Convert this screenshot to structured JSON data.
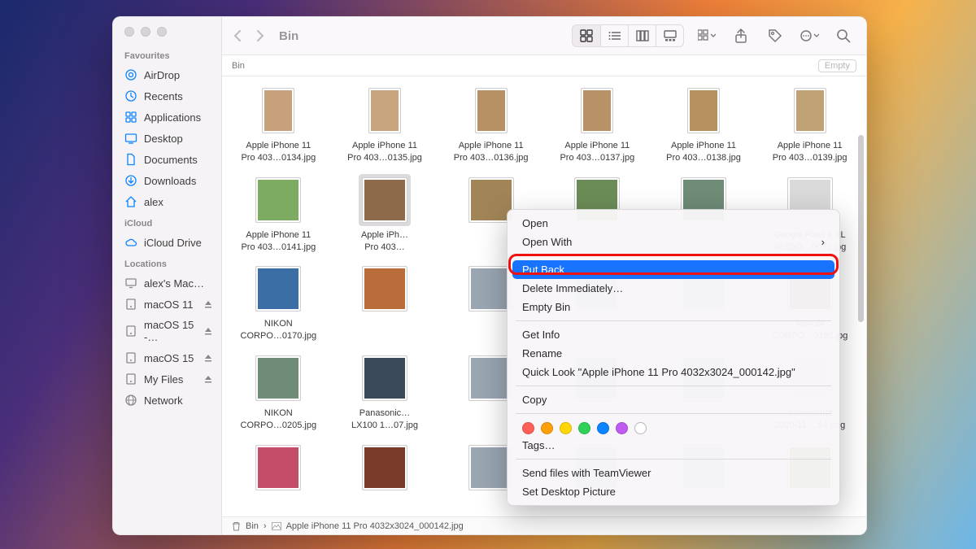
{
  "window": {
    "title": "Bin",
    "location_header": "Bin",
    "empty_button": "Empty"
  },
  "sidebar": {
    "sections": [
      {
        "label": "Favourites",
        "items": [
          {
            "name": "AirDrop",
            "icon": "airdrop"
          },
          {
            "name": "Recents",
            "icon": "clock"
          },
          {
            "name": "Applications",
            "icon": "apps"
          },
          {
            "name": "Desktop",
            "icon": "desktop"
          },
          {
            "name": "Documents",
            "icon": "doc"
          },
          {
            "name": "Downloads",
            "icon": "download"
          },
          {
            "name": "alex",
            "icon": "home"
          }
        ]
      },
      {
        "label": "iCloud",
        "items": [
          {
            "name": "iCloud Drive",
            "icon": "cloud"
          }
        ]
      },
      {
        "label": "Locations",
        "items": [
          {
            "name": "alex's Mac…",
            "icon": "computer"
          },
          {
            "name": "macOS 11",
            "icon": "disk",
            "eject": true
          },
          {
            "name": "macOS 15 -…",
            "icon": "disk",
            "eject": true
          },
          {
            "name": "macOS 15",
            "icon": "disk",
            "eject": true
          },
          {
            "name": "My Files",
            "icon": "disk",
            "eject": true
          },
          {
            "name": "Network",
            "icon": "globe"
          }
        ]
      }
    ]
  },
  "files": [
    {
      "label": "Apple iPhone 11\nPro 403…0134.jpg",
      "kind": "portrait"
    },
    {
      "label": "Apple iPhone 11\nPro 403…0135.jpg",
      "kind": "portrait"
    },
    {
      "label": "Apple iPhone 11\nPro 403…0136.jpg",
      "kind": "portrait"
    },
    {
      "label": "Apple iPhone 11\nPro 403…0137.jpg",
      "kind": "portrait"
    },
    {
      "label": "Apple iPhone 11\nPro 403…0138.jpg",
      "kind": "portrait"
    },
    {
      "label": "Apple iPhone 11\nPro 403…0139.jpg",
      "kind": "portrait"
    },
    {
      "label": "Apple iPhone 11\nPro 403…0141.jpg"
    },
    {
      "label": "Apple iPh…\nPro 403…",
      "selected": true
    },
    {
      "label": ""
    },
    {
      "label": ""
    },
    {
      "label": ""
    },
    {
      "label": "Google Pixel 4 XL\n4032x3…0072.jpg"
    },
    {
      "label": "NIKON\nCORPO…0170.jpg"
    },
    {
      "label": ""
    },
    {
      "label": ""
    },
    {
      "label": ""
    },
    {
      "label": ""
    },
    {
      "label": "NIKON\nCORPO…0192.jpg"
    },
    {
      "label": "NIKON\nCORPO…0205.jpg"
    },
    {
      "label": "Panasonic…\nLX100 1…07.jpg"
    },
    {
      "label": ""
    },
    {
      "label": ""
    },
    {
      "label": ""
    },
    {
      "label": "Screenshot\n2020-11….54.png"
    },
    {
      "label": ""
    },
    {
      "label": ""
    },
    {
      "label": ""
    },
    {
      "label": ""
    },
    {
      "label": ""
    },
    {
      "label": ""
    }
  ],
  "context_menu": {
    "open": "Open",
    "open_with": "Open With",
    "put_back": "Put Back",
    "delete_immediately": "Delete Immediately…",
    "empty_bin": "Empty Bin",
    "get_info": "Get Info",
    "rename": "Rename",
    "quick_look": "Quick Look \"Apple iPhone 11 Pro 4032x3024_000142.jpg\"",
    "copy": "Copy",
    "tags": "Tags…",
    "send_tv": "Send files with TeamViewer",
    "set_desktop": "Set Desktop Picture",
    "tag_colors": [
      "#ff5f57",
      "#ff9f0a",
      "#ffd60a",
      "#30d158",
      "#0a84ff",
      "#bf5af2",
      "#ffffff"
    ]
  },
  "path_bar": {
    "root": "Bin",
    "current": "Apple iPhone 11 Pro 4032x3024_000142.jpg",
    "sep": "›"
  },
  "thumb_colors": [
    "#c6a17b",
    "#c8a57e",
    "#b79163",
    "#b89266",
    "#b6915f",
    "#c0a274",
    "#7eab62",
    "#8c6a4a",
    "#a18557",
    "#6b8c57",
    "#6e8c78",
    "#dadada",
    "#3a6ea5",
    "#b86d3a",
    "#9aa6b2",
    "#9aa6b2",
    "#9aa6b2",
    "#7a6a55",
    "#6e8c78",
    "#3a4a5a",
    "#9aa6b2",
    "#9aa6b2",
    "#9aa6b2",
    "#e8e0e8",
    "#c44d6a",
    "#7a3a2a",
    "#9aa6b2",
    "#9aa6b2",
    "#9aa6b2",
    "#4a7a3a"
  ]
}
